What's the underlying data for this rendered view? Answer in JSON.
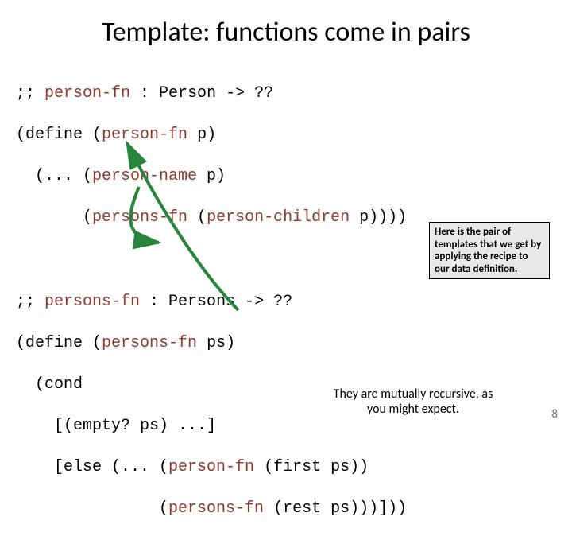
{
  "title": "Template: functions come in pairs",
  "code1": {
    "l1_a": ";; ",
    "l1_b": "person-fn",
    "l1_c": " : Person -> ??",
    "l2_a": "(define (",
    "l2_b": "person-fn",
    "l2_c": " p)",
    "l3_a": "  (... (",
    "l3_b": "person-name",
    "l3_c": " p)",
    "l4_a": "       (",
    "l4_b": "persons-fn",
    "l4_c": " (",
    "l4_d": "person-children",
    "l4_e": " p))))"
  },
  "code2": {
    "l1_a": ";; ",
    "l1_b": "persons-fn",
    "l1_c": " : Persons -> ??",
    "l2_a": "(define (",
    "l2_b": "persons-fn",
    "l2_c": " ps)",
    "l3": "  (cond",
    "l4": "    [(empty? ps) ...]",
    "l5_a": "    [else (... (",
    "l5_b": "person-fn",
    "l5_c": " (first ps))",
    "l6_a": "               (",
    "l6_b": "persons-fn",
    "l6_c": " (rest ps)))]))"
  },
  "callout1": "Here is the pair of templates that we get by applying the recipe to our data definition.",
  "callout2": "They are mutually recursive, as you might expect.",
  "pagenum": "8"
}
